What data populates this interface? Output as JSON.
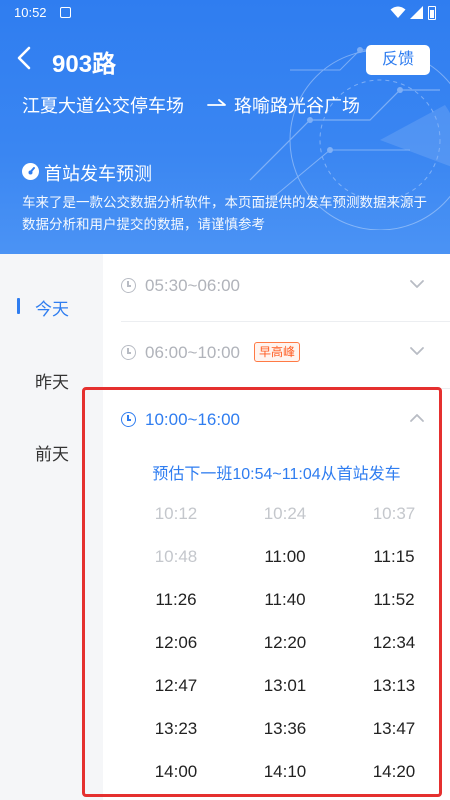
{
  "status_bar": {
    "time": "10:52"
  },
  "header": {
    "route": "903路",
    "feedback_label": "反馈",
    "from_stop": "江夏大道公交停车场",
    "to_stop": "珞喻路光谷广场",
    "predict_title": "首站发车预测",
    "disclaimer": "车来了是一款公交数据分析软件，本页面提供的发车预测数据来源于数据分析和用户提交的数据，请谨慎参考"
  },
  "sidebar": {
    "items": [
      {
        "label": "今天",
        "active": true
      },
      {
        "label": "昨天",
        "active": false
      },
      {
        "label": "前天",
        "active": false
      }
    ]
  },
  "slots": [
    {
      "label": "05:30~06:00",
      "badge": "",
      "expanded": false
    },
    {
      "label": "06:00~10:00",
      "badge": "早高峰",
      "expanded": false
    },
    {
      "label": "10:00~16:00",
      "badge": "",
      "expanded": true
    }
  ],
  "next_departure": "预估下一班10:54~11:04从首站发车",
  "departures": [
    {
      "time": "10:12",
      "past": true
    },
    {
      "time": "10:24",
      "past": true
    },
    {
      "time": "10:37",
      "past": true
    },
    {
      "time": "10:48",
      "past": true
    },
    {
      "time": "11:00",
      "past": false
    },
    {
      "time": "11:15",
      "past": false
    },
    {
      "time": "11:26",
      "past": false
    },
    {
      "time": "11:40",
      "past": false
    },
    {
      "time": "11:52",
      "past": false
    },
    {
      "time": "12:06",
      "past": false
    },
    {
      "time": "12:20",
      "past": false
    },
    {
      "time": "12:34",
      "past": false
    },
    {
      "time": "12:47",
      "past": false
    },
    {
      "time": "13:01",
      "past": false
    },
    {
      "time": "13:13",
      "past": false
    },
    {
      "time": "13:23",
      "past": false
    },
    {
      "time": "13:36",
      "past": false
    },
    {
      "time": "13:47",
      "past": false
    },
    {
      "time": "14:00",
      "past": false
    },
    {
      "time": "14:10",
      "past": false
    },
    {
      "time": "14:20",
      "past": false
    }
  ],
  "colors": {
    "primary": "#2f7df0",
    "highlight": "#e5302f",
    "badge": "#ff5a1f"
  }
}
